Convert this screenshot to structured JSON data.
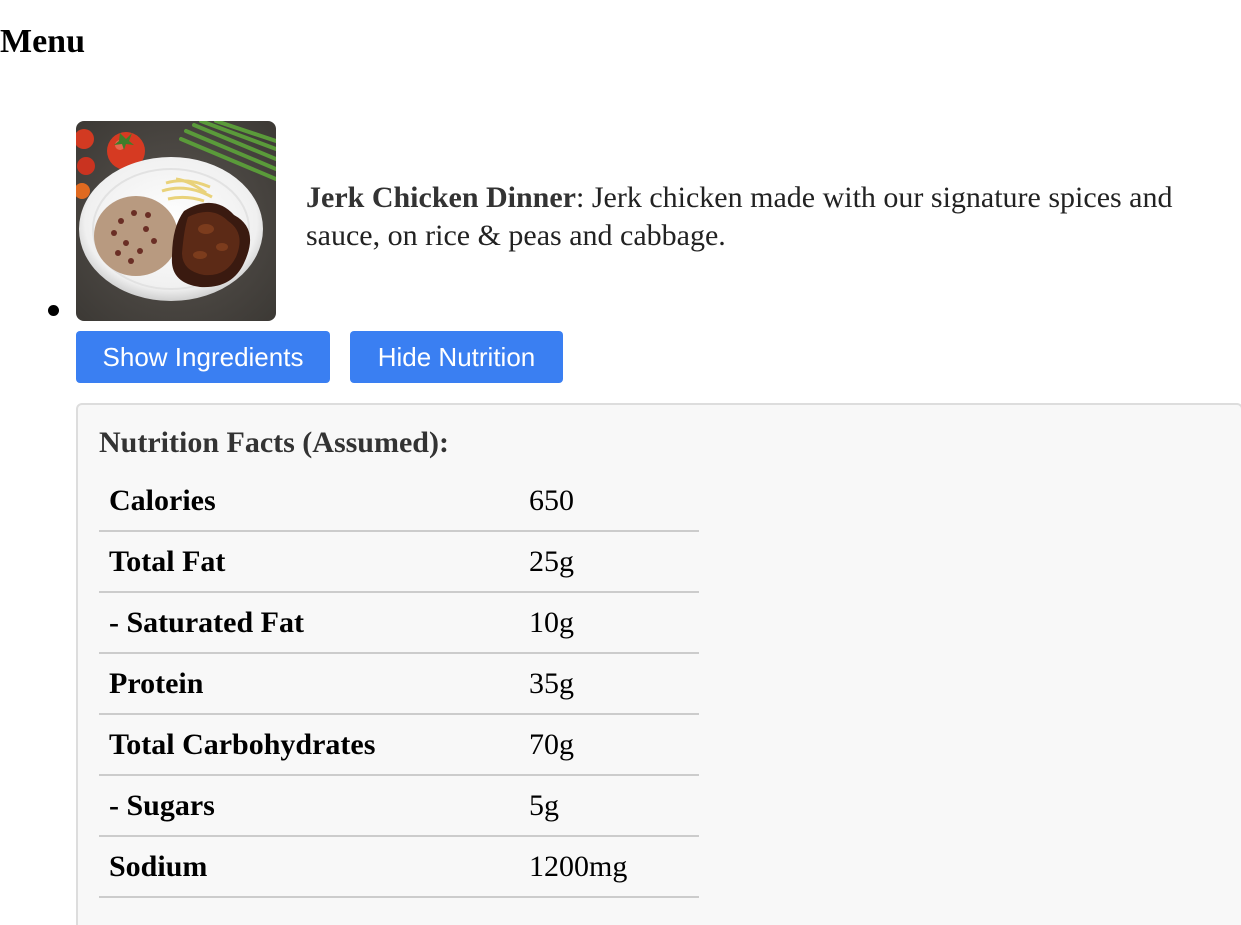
{
  "page": {
    "title": "Menu"
  },
  "menu_item": {
    "name": "Jerk Chicken Dinner",
    "separator": ": ",
    "description": "Jerk chicken made with our signature spices and sauce, on rice & peas and cabbage.",
    "image_icon": "jerk-chicken-dinner-photo"
  },
  "buttons": {
    "ingredients_label": "Show Ingredients",
    "nutrition_label": "Hide Nutrition"
  },
  "nutrition": {
    "title": "Nutrition Facts (Assumed):",
    "rows": [
      {
        "name": "Calories",
        "value": "650"
      },
      {
        "name": "Total Fat",
        "value": "25g"
      },
      {
        "name": "- Saturated Fat",
        "value": "10g"
      },
      {
        "name": "Protein",
        "value": "35g"
      },
      {
        "name": "Total Carbohydrates",
        "value": "70g"
      },
      {
        "name": "- Sugars",
        "value": "5g"
      },
      {
        "name": "Sodium",
        "value": "1200mg"
      }
    ]
  },
  "colors": {
    "button_bg": "#3a7ff2",
    "panel_bg": "#f8f8f8",
    "panel_border": "#dddddd"
  }
}
